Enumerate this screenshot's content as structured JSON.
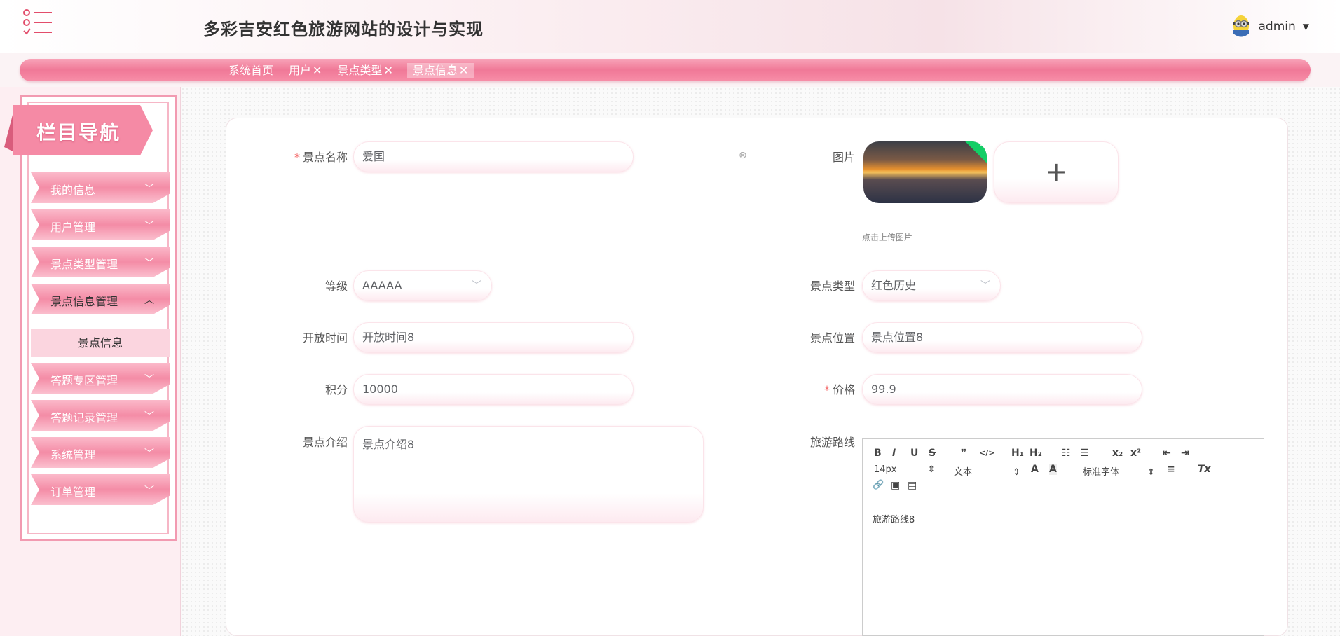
{
  "header": {
    "title": "多彩吉安红色旅游网站的设计与实现",
    "user": "admin"
  },
  "tabs": [
    {
      "label": "系统首页",
      "closable": false
    },
    {
      "label": "用户",
      "closable": true
    },
    {
      "label": "景点类型",
      "closable": true
    },
    {
      "label": "景点信息",
      "closable": true,
      "active": true
    }
  ],
  "tab_close": "✕",
  "sidebar": {
    "title": "栏目导航",
    "items": [
      {
        "label": "我的信息"
      },
      {
        "label": "用户管理"
      },
      {
        "label": "景点类型管理"
      },
      {
        "label": "景点信息管理",
        "open": true
      },
      {
        "label": "答题专区管理"
      },
      {
        "label": "答题记录管理"
      },
      {
        "label": "系统管理"
      },
      {
        "label": "订单管理"
      }
    ],
    "sub_item": "景点信息"
  },
  "form": {
    "name_label": "景点名称",
    "name_value": "爱国",
    "image_label": "图片",
    "upload_tip": "点击上传图片",
    "upload_plus": "+",
    "level_label": "等级",
    "level_value": "AAAAA",
    "type_label": "景点类型",
    "type_value": "红色历史",
    "open_time_label": "开放时间",
    "open_time_value": "开放时间8",
    "location_label": "景点位置",
    "location_value": "景点位置8",
    "points_label": "积分",
    "points_value": "10000",
    "price_label": "价格",
    "price_value": "99.9",
    "intro_label": "景点介绍",
    "intro_value": "景点介绍8",
    "route_label": "旅游路线",
    "route_value": "旅游路线8",
    "required_mark": "*"
  },
  "editor_toolbar": {
    "bold": "B",
    "italic": "I",
    "underline": "U",
    "strike": "S",
    "quote": "❞",
    "code": "</>",
    "h1": "H₁",
    "h2": "H₂",
    "ol": "☷",
    "ul": "☰",
    "sub": "x₂",
    "sup": "x²",
    "indent_less": "⇤",
    "indent_more": "⇥",
    "size": "14px",
    "block": "文本",
    "font": "标准字体",
    "color": "A",
    "bg": "A",
    "align": "≡",
    "clear": "Tx",
    "link": "🔗",
    "image": "▣",
    "video": "▤"
  }
}
